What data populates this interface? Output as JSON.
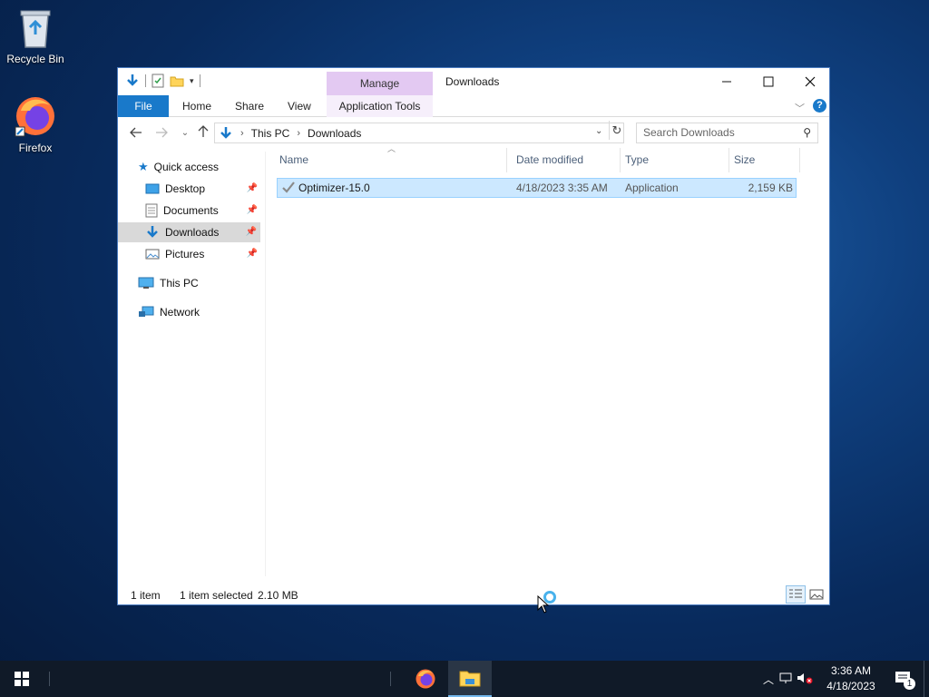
{
  "desktop": {
    "icons": [
      {
        "label": "Recycle Bin",
        "icon": "recycle-bin-icon"
      },
      {
        "label": "Firefox",
        "icon": "firefox-icon"
      }
    ]
  },
  "window": {
    "title": "Downloads",
    "contextual_tab_group": "Manage",
    "ribbon_tabs": [
      "File",
      "Home",
      "Share",
      "View",
      "Application Tools"
    ],
    "breadcrumb": [
      "This PC",
      "Downloads"
    ],
    "search_placeholder": "Search Downloads",
    "nav": {
      "quick_access": "Quick access",
      "pinned": [
        "Desktop",
        "Documents",
        "Downloads",
        "Pictures"
      ],
      "this_pc": "This PC",
      "network": "Network"
    },
    "columns": [
      "Name",
      "Date modified",
      "Type",
      "Size"
    ],
    "files": [
      {
        "name": "Optimizer-15.0",
        "date": "4/18/2023 3:35 AM",
        "type": "Application",
        "size": "2,159 KB"
      }
    ],
    "status": {
      "count": "1 item",
      "selection": "1 item selected",
      "selection_size": "2.10 MB"
    }
  },
  "taskbar": {
    "time": "3:36 AM",
    "date": "4/18/2023",
    "notification_count": "1"
  },
  "colors": {
    "accent": "#1979ca",
    "manage_tab": "#e3c9f2",
    "selection": "#cce8ff",
    "taskbar": "#101a28"
  }
}
